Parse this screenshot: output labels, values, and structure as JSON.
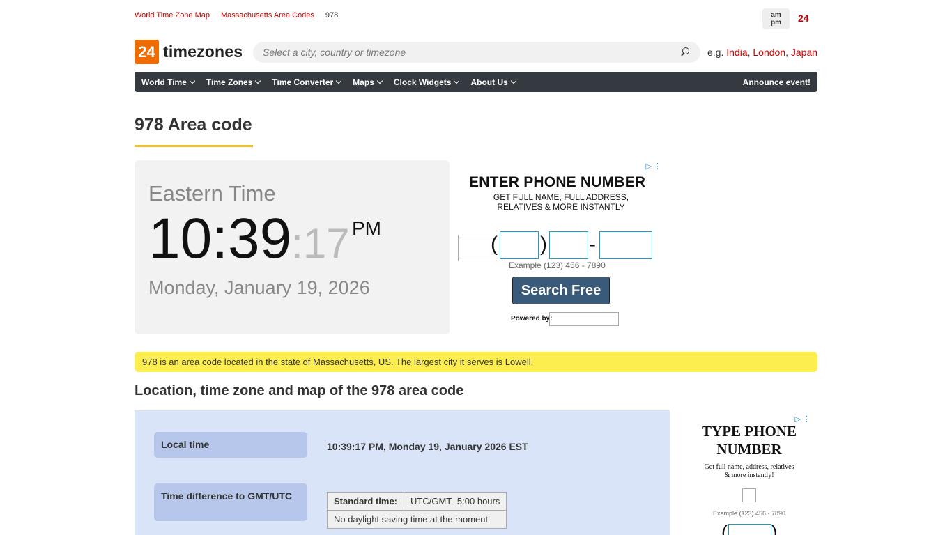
{
  "breadcrumb": [
    "World Time Zone Map",
    "Massachusetts Area Codes"
  ],
  "breadcrumb_current": "978",
  "format_toggle": {
    "ampm_top": "am",
    "ampm_bottom": "pm",
    "h24": "24"
  },
  "logo": {
    "badge": "24",
    "text": "timezones"
  },
  "search": {
    "placeholder": "Select a city, country or timezone"
  },
  "examples": {
    "prefix": "e.g.",
    "links": [
      "India",
      "London",
      "Japan"
    ]
  },
  "nav": {
    "items": [
      "World Time",
      "Time Zones",
      "Time Converter",
      "Maps",
      "Clock Widgets",
      "About Us"
    ],
    "announce": "Announce event!"
  },
  "page": {
    "title": "978 Area code"
  },
  "clock": {
    "zone": "Eastern Time",
    "hm": "10:39",
    "secs": ":17",
    "ampm": "PM",
    "date": "Monday, January 19, 2026"
  },
  "ad1": {
    "headline": "ENTER PHONE NUMBER",
    "sub1": "GET FULL NAME, FULL ADDRESS,",
    "sub2": "RELATIVES & MORE INSTANTLY",
    "open_paren": "(",
    "close_paren": ")",
    "dash": "-",
    "example": "Example (123) 456 - 7890",
    "button": "Search Free",
    "powered": "Powered by:"
  },
  "notice": "978 is an area code located in the state of Massachusetts, US. The largest city it serves is Lowell.",
  "section": {
    "title": "Location, time zone and map of the 978 area code"
  },
  "info": {
    "local_time_label": "Local time",
    "local_time_value": "10:39:17 PM, Monday 19, January 2026 EST",
    "diff_label": "Time difference to GMT/UTC",
    "std_key": "Standard time:",
    "std_value": "UTC/GMT -5:00 hours",
    "dst_note": "No daylight saving time at the moment"
  },
  "ad2": {
    "headline1": "TYPE PHONE",
    "headline2": "NUMBER",
    "sub1": "Get full name, address, relatives",
    "sub2": "& more instantly!",
    "example": "Example (123) 456 - 7890",
    "open_paren": "(",
    "close_paren": ")"
  },
  "colors": {
    "accent": "#cc0000",
    "logo": "#ef6c00",
    "nav": "#343a40",
    "notice": "#fdee4f",
    "panel": "#dae4f8"
  }
}
